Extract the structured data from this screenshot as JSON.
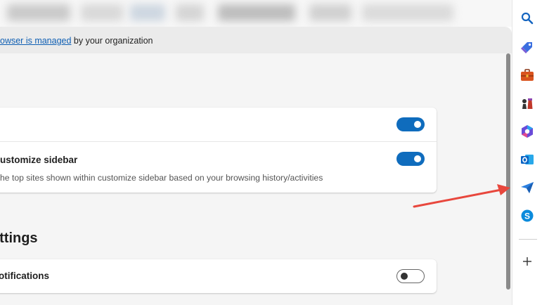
{
  "managed_bar": {
    "link_text": "owser is managed",
    "suffix_text": " by your organization"
  },
  "settings_card": {
    "row1": {
      "toggle_state": "on"
    },
    "row2": {
      "title": "ustomize sidebar",
      "description": "he top sites shown within customize sidebar based on your browsing history/activities",
      "toggle_state": "on"
    }
  },
  "section": {
    "heading": "ettings",
    "row": {
      "title": "otifications",
      "toggle_state": "off"
    }
  },
  "sidebar": {
    "items": [
      {
        "icon": "search-icon"
      },
      {
        "icon": "shopping-tag-icon"
      },
      {
        "icon": "tools-briefcase-icon"
      },
      {
        "icon": "games-chess-icon"
      },
      {
        "icon": "microsoft-365-icon"
      },
      {
        "icon": "outlook-icon"
      },
      {
        "icon": "drop-send-icon"
      },
      {
        "icon": "skype-icon"
      }
    ],
    "add_icon": "plus-icon"
  },
  "colors": {
    "accent": "#0f6cbd",
    "arrow": "#e8473d",
    "link": "#0f5fb3"
  }
}
